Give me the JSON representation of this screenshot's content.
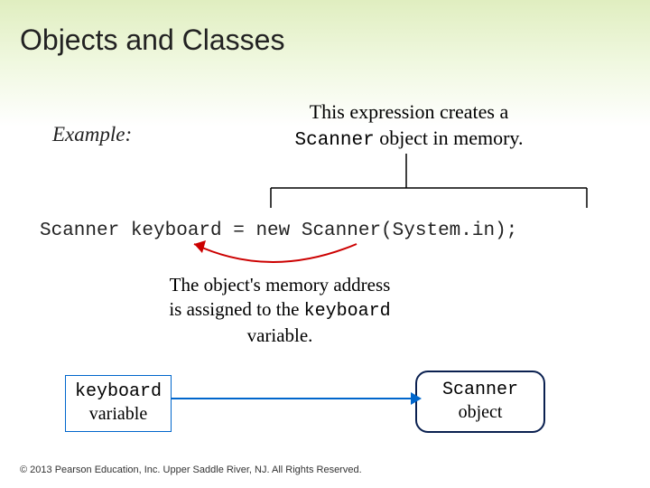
{
  "title": "Objects and Classes",
  "example_label": "Example:",
  "note_top_line1": "This expression creates a",
  "note_top_mono": "Scanner",
  "note_top_line2_rest": " object in memory.",
  "code": "Scanner keyboard = new Scanner(System.in);",
  "note_mid_line1": "The object's memory address",
  "note_mid_line2_pre": "is assigned to the ",
  "note_mid_mono": "keyboard",
  "note_mid_line3": "variable.",
  "kb_box_mono": "keyboard",
  "kb_box_text": "variable",
  "sc_box_mono": "Scanner",
  "sc_box_text": "object",
  "copyright": "© 2013 Pearson Education, Inc. Upper Saddle River, NJ. All Rights Reserved."
}
